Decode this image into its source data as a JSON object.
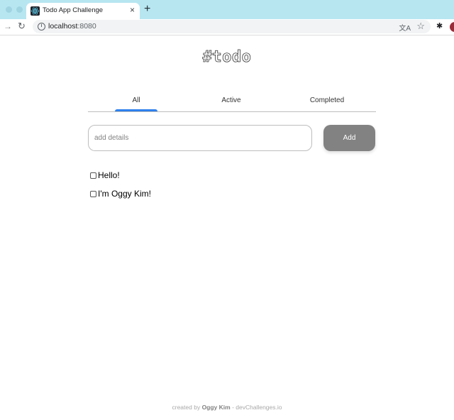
{
  "browser": {
    "tab": {
      "title": "Todo App Challenge",
      "close": "×"
    },
    "new_tab": "+",
    "address": {
      "host": "localhost",
      "port": ":8080"
    }
  },
  "app": {
    "title": "#todo",
    "filters": [
      {
        "label": "All",
        "selected": true
      },
      {
        "label": "Active",
        "selected": false
      },
      {
        "label": "Completed",
        "selected": false
      }
    ],
    "input": {
      "placeholder": "add details",
      "value": ""
    },
    "add_button": "Add",
    "todos": [
      {
        "text": "Hello!",
        "checked": false
      },
      {
        "text": "I'm Oggy Kim!",
        "checked": false
      }
    ],
    "footer": {
      "prefix": "created by ",
      "author": "Oggy Kim",
      "suffix": " - devChallenges.io"
    }
  },
  "colors": {
    "accent": "#2f80ed",
    "button": "#828282",
    "tabstrip": "#b7e6f1"
  }
}
